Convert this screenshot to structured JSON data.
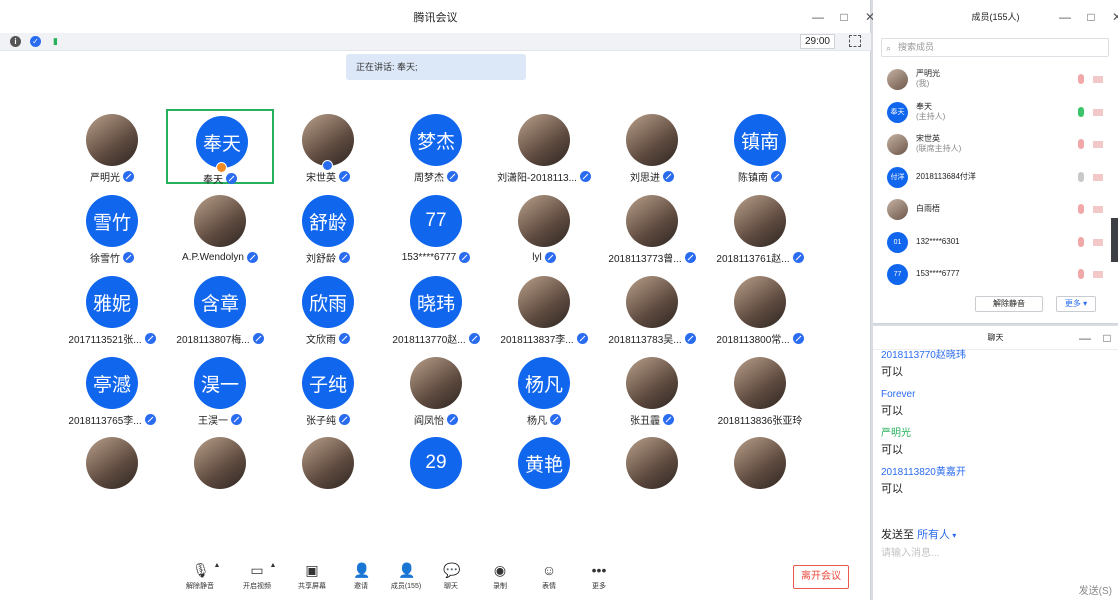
{
  "window": {
    "title": "腾讯会议",
    "timer": "29:00"
  },
  "speaking_banner": "正在讲话: 奉天;",
  "participants": [
    {
      "name": "严明光",
      "avatar": "photo",
      "text": ""
    },
    {
      "name": "奉天",
      "avatar": "blue",
      "text": "奉天",
      "host": true,
      "active": true
    },
    {
      "name": "宋世英",
      "avatar": "photo",
      "text": "",
      "share": true
    },
    {
      "name": "周梦杰",
      "avatar": "blue",
      "text": "梦杰"
    },
    {
      "name": "刘潇阳-2018113...",
      "avatar": "photo",
      "text": ""
    },
    {
      "name": "刘思进",
      "avatar": "photo",
      "text": ""
    },
    {
      "name": "陈镇南",
      "avatar": "blue",
      "text": "镇南"
    },
    {
      "name": "徐雪竹",
      "avatar": "blue",
      "text": "雪竹"
    },
    {
      "name": "A.P.Wendolyn",
      "avatar": "photo",
      "text": ""
    },
    {
      "name": "刘舒龄",
      "avatar": "blue",
      "text": "舒龄"
    },
    {
      "name": "153****6777",
      "avatar": "blue",
      "text": "77"
    },
    {
      "name": "lyl",
      "avatar": "photo",
      "text": ""
    },
    {
      "name": "2018113773曾...",
      "avatar": "photo",
      "text": ""
    },
    {
      "name": "2018113761赵...",
      "avatar": "photo",
      "text": ""
    },
    {
      "name": "2017113521张...",
      "avatar": "blue",
      "text": "雅妮"
    },
    {
      "name": "2018113807梅...",
      "avatar": "blue",
      "text": "含章"
    },
    {
      "name": "文欣雨",
      "avatar": "blue",
      "text": "欣雨"
    },
    {
      "name": "2018113770赵...",
      "avatar": "blue",
      "text": "晓玮"
    },
    {
      "name": "2018113837李...",
      "avatar": "photo",
      "text": ""
    },
    {
      "name": "2018113783吴...",
      "avatar": "photo",
      "text": ""
    },
    {
      "name": "2018113800常...",
      "avatar": "photo",
      "text": ""
    },
    {
      "name": "2018113765李...",
      "avatar": "blue",
      "text": "亭澸"
    },
    {
      "name": "王淏一",
      "avatar": "blue",
      "text": "淏一"
    },
    {
      "name": "张子纯",
      "avatar": "blue",
      "text": "子纯"
    },
    {
      "name": "阎凤怡",
      "avatar": "photo",
      "text": ""
    },
    {
      "name": "杨凡",
      "avatar": "blue",
      "text": "杨凡"
    },
    {
      "name": "张丑霾",
      "avatar": "photo",
      "text": ""
    },
    {
      "name": "2018113836张亚玲",
      "avatar": "photo",
      "text": "",
      "nomic": true
    },
    {
      "name": "",
      "avatar": "photo",
      "text": ""
    },
    {
      "name": "",
      "avatar": "photo",
      "text": ""
    },
    {
      "name": "",
      "avatar": "photo",
      "text": ""
    },
    {
      "name": "",
      "avatar": "blue",
      "text": "29"
    },
    {
      "name": "",
      "avatar": "blue",
      "text": "黄艳"
    },
    {
      "name": "",
      "avatar": "photo",
      "text": ""
    },
    {
      "name": "",
      "avatar": "photo",
      "text": ""
    }
  ],
  "toolbar": {
    "mute": "解除静音",
    "video": "开启视频",
    "share": "共享屏幕",
    "invite": "邀请",
    "members": "成员(155)",
    "chat": "聊天",
    "record": "录制",
    "emoji": "表情",
    "more": "更多",
    "leave": "离开会议"
  },
  "members_panel": {
    "title": "成员(155人)",
    "search_placeholder": "搜索成员",
    "rows": [
      {
        "name": "严明光",
        "sub": "(我)",
        "avatar": "photo",
        "text": "",
        "mic": "off"
      },
      {
        "name": "奉天",
        "sub": "(主持人)",
        "avatar": "blue",
        "text": "奉天",
        "mic": "on"
      },
      {
        "name": "宋世英",
        "sub": "(联席主持人)",
        "avatar": "photo",
        "text": "",
        "mic": "off"
      },
      {
        "name": "2018113684付洋",
        "sub": "",
        "avatar": "blue",
        "text": "付洋",
        "mic": "gray"
      },
      {
        "name": "白雨梧",
        "sub": "",
        "avatar": "photo",
        "text": "",
        "mic": "off"
      },
      {
        "name": "132****6301",
        "sub": "",
        "avatar": "blue",
        "text": "01",
        "mic": "off"
      },
      {
        "name": "153****6777",
        "sub": "",
        "avatar": "blue",
        "text": "77",
        "mic": "off"
      }
    ],
    "unmute_all": "解除静音",
    "more": "更多 ▾"
  },
  "chat_panel": {
    "title": "聊天",
    "messages": [
      {
        "sender": "2018113770赵晓玮",
        "text": "可以",
        "green": false
      },
      {
        "sender": "Forever",
        "text": "可以",
        "green": false
      },
      {
        "sender": "严明光",
        "text": "可以",
        "green": true
      },
      {
        "sender": "2018113820黄嘉开",
        "text": "可以",
        "green": false
      }
    ],
    "send_to_label": "发送至",
    "send_to_target": "所有人",
    "input_placeholder": "请输入消息...",
    "send": "发送(S)"
  },
  "colors": {
    "accent": "#1166ee",
    "active_border": "#27b15d",
    "leave": "#e84a3f"
  }
}
